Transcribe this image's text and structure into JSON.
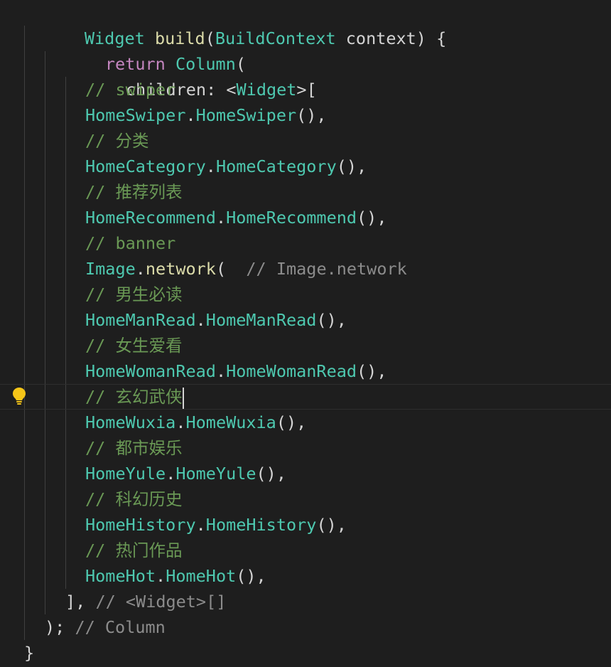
{
  "editor": {
    "lines": {
      "l1": {
        "t1": "Widget",
        "t2": "build",
        "t3": "(",
        "t4": "BuildContext",
        "t5": " context) {"
      },
      "l2": {
        "t1": "return",
        "t2": "Column",
        "t3": "("
      },
      "l3": {
        "t1": "children: <",
        "t2": "Widget",
        "t3": ">["
      },
      "l4": {
        "comment": "// swiper"
      },
      "l5": {
        "t1": "HomeSwiper",
        "t2": ".",
        "t3": "HomeSwiper",
        "t4": "(),"
      },
      "l6": {
        "comment": "// 分类"
      },
      "l7": {
        "t1": "HomeCategory",
        "t2": ".",
        "t3": "HomeCategory",
        "t4": "(),"
      },
      "l8": {
        "comment": "// 推荐列表"
      },
      "l9": {
        "t1": "HomeRecommend",
        "t2": ".",
        "t3": "HomeRecommend",
        "t4": "(),"
      },
      "l10": {
        "comment": "// banner"
      },
      "l11": {
        "t1": "Image",
        "t2": ".",
        "t3": "network",
        "t4": "(",
        "hint": "// Image.network"
      },
      "l12": {
        "comment": "// 男生必读"
      },
      "l13": {
        "t1": "HomeManRead",
        "t2": ".",
        "t3": "HomeManRead",
        "t4": "(),"
      },
      "l14": {
        "comment": "// 女生爱看"
      },
      "l15": {
        "t1": "HomeWomanRead",
        "t2": ".",
        "t3": "HomeWomanRead",
        "t4": "(),"
      },
      "l16": {
        "comment": "// 玄幻武侠"
      },
      "l17": {
        "t1": "HomeWuxia",
        "t2": ".",
        "t3": "HomeWuxia",
        "t4": "(),"
      },
      "l18": {
        "comment": "// 都市娱乐"
      },
      "l19": {
        "t1": "HomeYule",
        "t2": ".",
        "t3": "HomeYule",
        "t4": "(),"
      },
      "l20": {
        "comment": "// 科幻历史"
      },
      "l21": {
        "t1": "HomeHistory",
        "t2": ".",
        "t3": "HomeHistory",
        "t4": "(),"
      },
      "l22": {
        "comment": "// 热门作品"
      },
      "l23": {
        "t1": "HomeHot",
        "t2": ".",
        "t3": "HomeHot",
        "t4": "(),"
      },
      "l24": {
        "t1": "],",
        "hint": "// <Widget>[]"
      },
      "l25": {
        "t1": ");",
        "hint": "// Column"
      },
      "l26": {
        "t1": "}"
      }
    },
    "lightbulb_icon": "lightbulb-icon",
    "colors": {
      "background": "#1e1e1e",
      "type": "#4ec9b0",
      "keyword": "#c586c0",
      "function": "#dcdcaa",
      "comment": "#6a9955",
      "hint": "#8c8c8c",
      "lightbulb": "#f5c518"
    }
  }
}
